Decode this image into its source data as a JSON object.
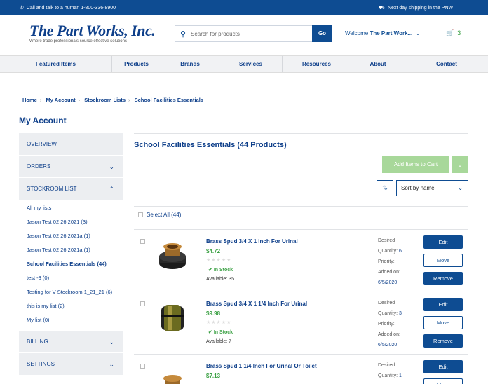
{
  "topbar": {
    "left": "Call and talk to a human 1-800-336-8900",
    "right": "Next day shipping in the PNW"
  },
  "header": {
    "logo": "The Part Works, Inc.",
    "tagline": "Where trade professionals source effective solutions",
    "search_placeholder": "Search for products",
    "go": "Go",
    "welcome": "Welcome",
    "user": "The Part Work...",
    "cart_count": "3"
  },
  "nav": [
    "Featured Items",
    "Products",
    "Brands",
    "Services",
    "Resources",
    "About",
    "Contact"
  ],
  "breadcrumb": [
    "Home",
    "My Account",
    "Stockroom Lists",
    "School Facilities Essentials"
  ],
  "page_title": "My Account",
  "sidebar": {
    "overview": "OVERVIEW",
    "orders": "ORDERS",
    "stockroom": "STOCKROOM LIST",
    "lists": [
      "All my lists",
      "Jason Test 02 26 2021 (3)",
      "Jason Test 02 26 2021a (1)",
      "Jason Test 02 26 2021a (1)",
      "School Facilities Essentials (44)",
      "test -3 (0)",
      "Testing for V Stockroom 1_21_21 (6)",
      "this is my list (2)",
      "My list (0)"
    ],
    "billing": "BILLING",
    "settings": "SETTINGS"
  },
  "main": {
    "title": "School Facilities Essentials (44 Products)",
    "add_to_cart": "Add Items to Cart",
    "sort": "Sort by name",
    "select_all": "Select All (44)"
  },
  "meta_labels": {
    "desired": "Desired",
    "quantity": "Quantity:",
    "priority": "Priority:",
    "added": "Added on:"
  },
  "actions": {
    "edit": "Edit",
    "move": "Move",
    "remove": "Remove"
  },
  "products": [
    {
      "name": "Brass Spud 3/4 X 1 Inch For Urinal",
      "price": "$4.72",
      "stock": "In Stock",
      "available": "Available: 35",
      "quantity": "6",
      "added": "6/5/2020"
    },
    {
      "name": "Brass Spud 3/4 X 1 1/4 Inch For Urinal",
      "price": "$9.98",
      "stock": "In Stock",
      "available": "Available: 7",
      "quantity": "3",
      "added": "6/5/2020"
    },
    {
      "name": "Brass Spud 1 1/4 Inch For Urinal Or Toilet",
      "price": "$7.13",
      "quantity": "1"
    }
  ],
  "colors": {
    "brand": "#0e4c92",
    "accent": "#3aa043",
    "button_disabled": "#a8d89a"
  }
}
